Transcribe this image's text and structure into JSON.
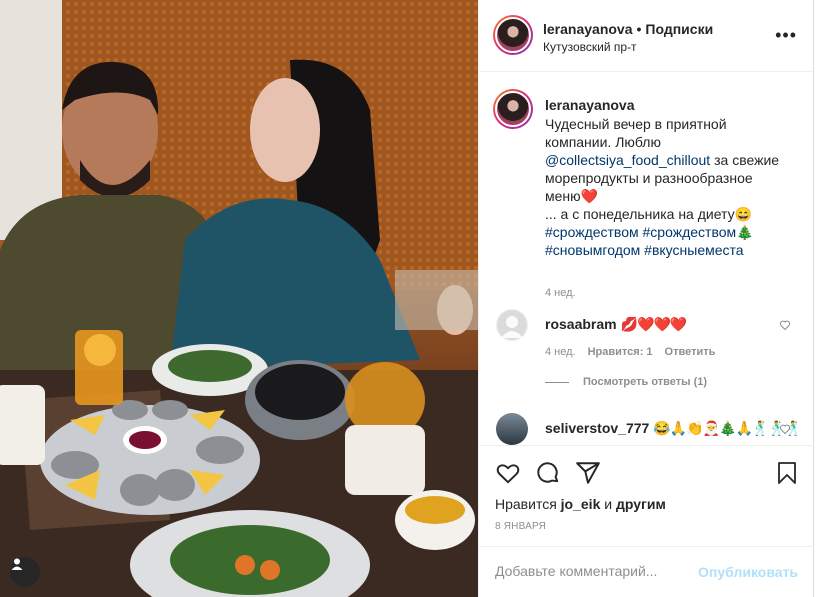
{
  "header": {
    "username": "leranayanova",
    "dot": "•",
    "follow_label": "Подписки",
    "location": "Кутузовский пр-т",
    "more_icon": "more-horizontal-icon"
  },
  "caption": {
    "username": "leranayanova",
    "text_1": "Чудесный вечер в приятной компании. Люблю ",
    "mention": "@collectsiya_food_chillout",
    "text_2": " за свежие морепродукты и разнообразное меню❤️\n... а с понедельника на диету😄\n",
    "hashtags": "#срождеством #срождеством🎄 #сновымгодом #вкусныеместа",
    "time": "4 нед."
  },
  "comments": [
    {
      "username": "rosaabram",
      "text": "💋❤️❤️❤️",
      "time": "4 нед.",
      "likes": "Нравится: 1",
      "reply": "Ответить",
      "view_replies": "Посмотреть ответы (1)"
    },
    {
      "username": "seliverstov_777",
      "text": "😂🙏👏🎅🎄🙏🕺🕺🕺"
    }
  ],
  "actions": {
    "like_icon": "heart-icon",
    "comment_icon": "comment-icon",
    "share_icon": "share-icon",
    "save_icon": "bookmark-icon"
  },
  "likes": {
    "prefix": "Нравится",
    "user": "jo_eik",
    "mid": "и",
    "others": "другим"
  },
  "date": "8 ЯНВАРЯ",
  "add_comment": {
    "placeholder": "Добавьте комментарий...",
    "post_label": "Опубликовать"
  },
  "colors": {
    "link": "#00376b",
    "post_disabled": "#b2dffc",
    "muted": "#8e8e8e"
  }
}
